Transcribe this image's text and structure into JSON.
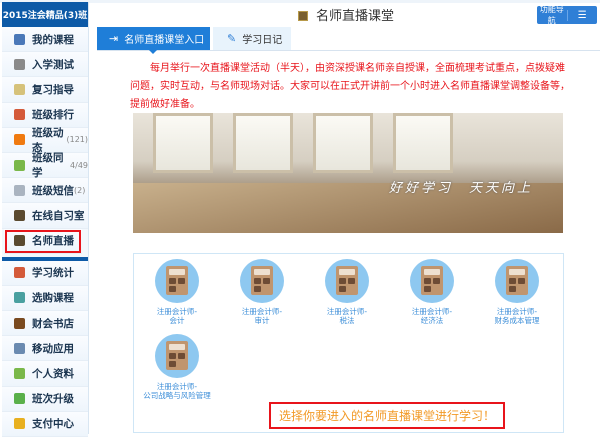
{
  "sidebar": {
    "header": "2015注会精品(3)班",
    "items": [
      {
        "label": "我的课程",
        "count": "",
        "icon": "monitor-icon",
        "color": "#4a78b8"
      },
      {
        "label": "入学测试",
        "count": "",
        "icon": "edit-icon",
        "color": "#8a8a8a"
      },
      {
        "label": "复习指导",
        "count": "",
        "icon": "note-icon",
        "color": "#d6c27a"
      },
      {
        "label": "班级排行",
        "count": "",
        "icon": "chart-icon",
        "color": "#d45a3a"
      },
      {
        "label": "班级动态",
        "count": "(121)",
        "icon": "refresh-icon",
        "color": "#f07a10"
      },
      {
        "label": "班级同学",
        "count": "4/49",
        "icon": "user-icon",
        "color": "#7ab84a"
      },
      {
        "label": "班级短信",
        "count": "(2)",
        "icon": "mail-icon",
        "color": "#aab4c0"
      },
      {
        "label": "在线自习室",
        "count": "",
        "icon": "classroom-icon",
        "color": "#5a4a30"
      },
      {
        "label": "名师直播",
        "count": "",
        "icon": "live-icon",
        "color": "#5a4a30"
      }
    ],
    "items2": [
      {
        "label": "学习统计",
        "icon": "stats-icon",
        "color": "#d45a3a"
      },
      {
        "label": "选购课程",
        "icon": "cart-icon",
        "color": "#4aa0a0"
      },
      {
        "label": "财会书店",
        "icon": "book-icon",
        "color": "#7a4a20"
      },
      {
        "label": "移动应用",
        "icon": "phone-icon",
        "color": "#6a8ab0"
      },
      {
        "label": "个人资料",
        "icon": "profile-icon",
        "color": "#7ab84a"
      },
      {
        "label": "班次升级",
        "icon": "upgrade-icon",
        "color": "#5ab04a"
      },
      {
        "label": "支付中心",
        "icon": "pay-icon",
        "color": "#e8b020"
      }
    ]
  },
  "header": {
    "title": "名师直播课堂",
    "func_nav": "功能导航"
  },
  "tabs": [
    {
      "label": "名师直播课堂入口"
    },
    {
      "label": "学习日记"
    }
  ],
  "notice": "每月举行一次直播课堂活动（半天），由资深授课名师亲自授课，全面梳理考试重点，点拨疑难问题，实时互动，与名师现场对话。大家可以在正式开讲前一个小时进入名师直播课堂调整设备等，提前做好准备。",
  "banner_text": "好好学习　天天向上",
  "courses": [
    {
      "line1": "注册会计师-",
      "line2": "会计"
    },
    {
      "line1": "注册会计师-",
      "line2": "审计"
    },
    {
      "line1": "注册会计师-",
      "line2": "税法"
    },
    {
      "line1": "注册会计师-",
      "line2": "经济法"
    },
    {
      "line1": "注册会计师-",
      "line2": "财务成本管理"
    },
    {
      "line1": "注册会计师-",
      "line2": "公司战略与风险管理"
    }
  ],
  "choose_prompt": "选择你要进入的名师直播课堂进行学习！",
  "colors": {
    "accent": "#1f7ed8",
    "sidebar_header": "#0d5aa7",
    "highlight": "#e8141b",
    "prompt": "#f29a27"
  }
}
